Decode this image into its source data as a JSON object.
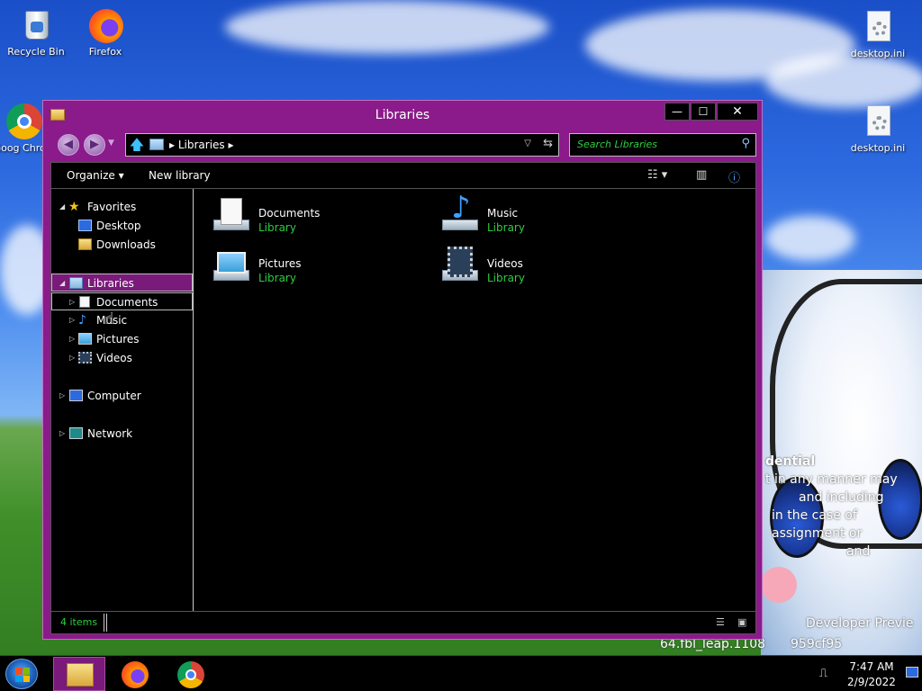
{
  "desktop": {
    "icons": [
      {
        "label": "Recycle Bin"
      },
      {
        "label": "Firefox"
      },
      {
        "label": "Goog Chrom"
      },
      {
        "label": "desktop.ini"
      },
      {
        "label": "desktop.ini"
      }
    ],
    "watermark_lines": [
      "dential",
      "t in any manner may",
      "and including",
      "in the case of",
      "assignment or",
      "and",
      "Developer Previe",
      "64.fbl_leap.1108",
      "959cf95"
    ]
  },
  "window": {
    "title": "Libraries",
    "buttons": {
      "minimize": "—",
      "maximize": "☐",
      "close": "✕"
    },
    "address": {
      "crumb": "Libraries"
    },
    "search": {
      "placeholder": "Search Libraries"
    },
    "toolbar": {
      "organize": "Organize",
      "new_library": "New library"
    },
    "nav": {
      "favorites": "Favorites",
      "desktop": "Desktop",
      "downloads": "Downloads",
      "libraries": "Libraries",
      "documents": "Documents",
      "music": "Music",
      "pictures": "Pictures",
      "videos": "Videos",
      "computer": "Computer",
      "network": "Network"
    },
    "libraries": [
      {
        "name": "Documents",
        "kind": "Library",
        "icon": "documents-library-icon"
      },
      {
        "name": "Music",
        "kind": "Library",
        "icon": "music-library-icon"
      },
      {
        "name": "Pictures",
        "kind": "Library",
        "icon": "pictures-library-icon"
      },
      {
        "name": "Videos",
        "kind": "Library",
        "icon": "videos-library-icon"
      }
    ],
    "status": {
      "count": "4 items"
    }
  },
  "taskbar": {
    "time": "7:47 AM",
    "date": "2/9/2022"
  },
  "colors": {
    "window_frame": "#8b1a8b",
    "library_label": "#2ecc40",
    "selected": "#7a1a7a"
  }
}
